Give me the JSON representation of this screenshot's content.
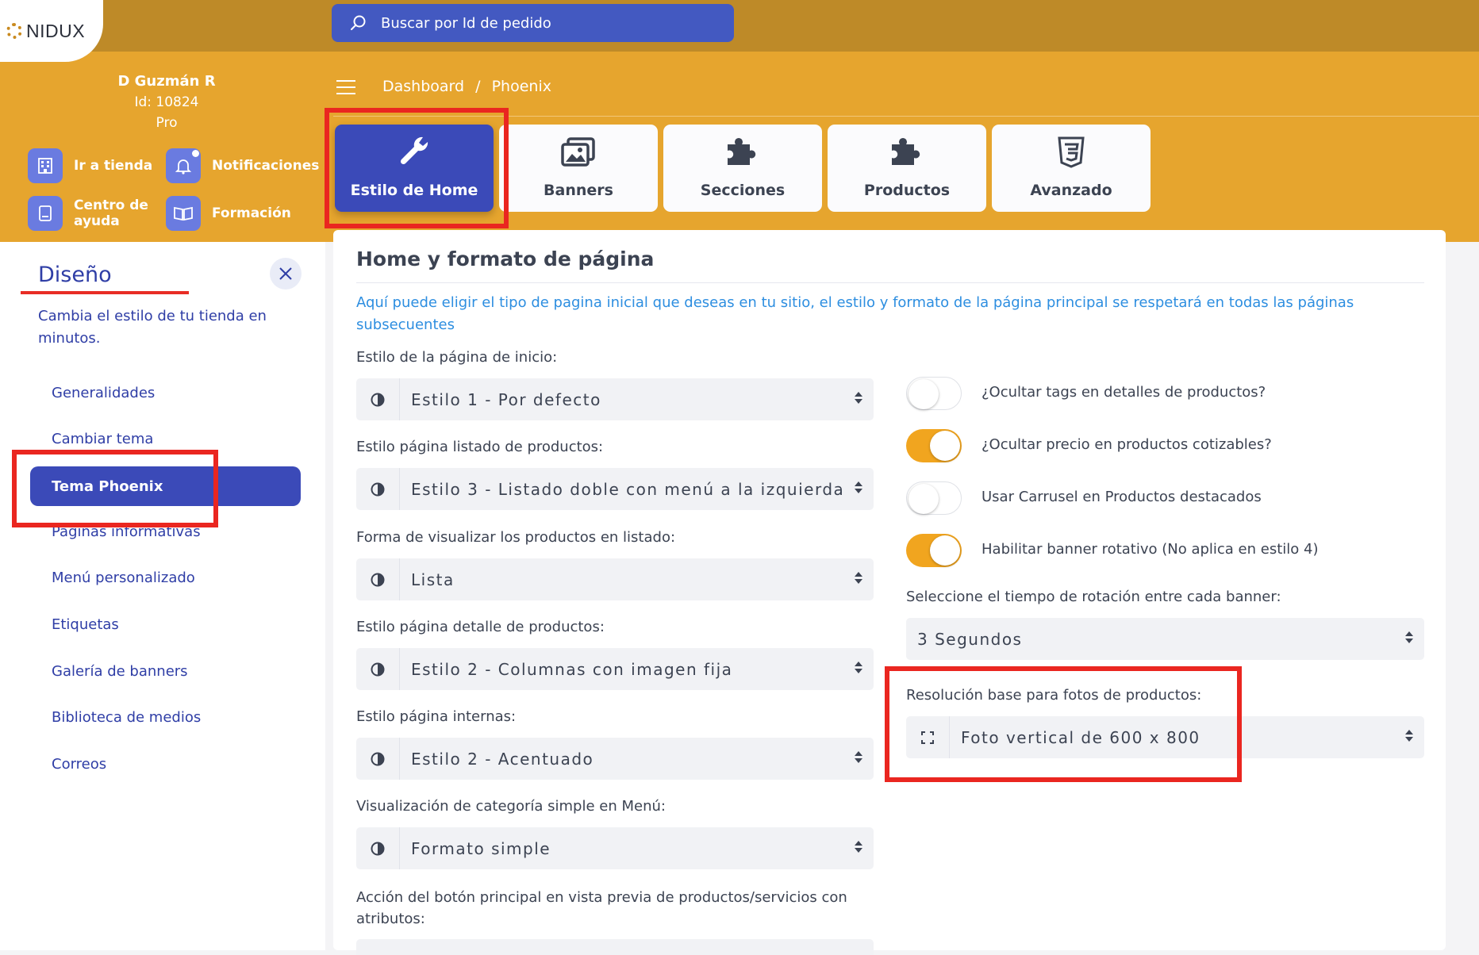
{
  "brand": {
    "name": "NIDUX"
  },
  "search": {
    "placeholder": "Buscar por Id de pedido"
  },
  "user": {
    "name": "D Guzmán R",
    "id": "Id: 10824",
    "plan": "Pro"
  },
  "quick_links": [
    {
      "label": "Ir a tienda",
      "icon": "store-icon"
    },
    {
      "label": "Notificaciones",
      "icon": "bell-icon"
    },
    {
      "label": "Centro de ayuda",
      "icon": "book-icon"
    },
    {
      "label": "Formación",
      "icon": "open-book-icon"
    }
  ],
  "breadcrumb": {
    "home": "Dashboard",
    "separator": "/",
    "current": "Phoenix"
  },
  "tabs": [
    {
      "label": "Estilo de Home",
      "icon": "wrench-icon",
      "active": true
    },
    {
      "label": "Banners",
      "icon": "images-icon"
    },
    {
      "label": "Secciones",
      "icon": "puzzle-icon"
    },
    {
      "label": "Productos",
      "icon": "puzzle-icon"
    },
    {
      "label": "Avanzado",
      "icon": "css3-icon"
    }
  ],
  "sidebar": {
    "title": "Diseño",
    "description": "Cambia el estilo de tu tienda en minutos.",
    "items": [
      {
        "label": "Generalidades"
      },
      {
        "label": "Cambiar tema"
      },
      {
        "label": "Tema Phoenix",
        "active": true
      },
      {
        "label": "Páginas informativas"
      },
      {
        "label": "Menú personalizado"
      },
      {
        "label": "Etiquetas"
      },
      {
        "label": "Galería de banners"
      },
      {
        "label": "Biblioteca de medios"
      },
      {
        "label": "Correos"
      }
    ]
  },
  "main": {
    "title": "Home y formato de página",
    "info": "Aquí puede eligir el tipo de pagina inicial que deseas en tu sitio, el estilo y formato de la página principal se respetará en todas las páginas subsecuentes",
    "left_fields": [
      {
        "label": "Estilo de la página de inicio:",
        "value": "Estilo 1 - Por defecto"
      },
      {
        "label": "Estilo página listado de productos:",
        "value": "Estilo 3 - Listado doble con menú a la izquierda"
      },
      {
        "label": "Forma de visualizar los productos en listado:",
        "value": "Lista"
      },
      {
        "label": "Estilo página detalle de productos:",
        "value": "Estilo 2 - Columnas con imagen fija"
      },
      {
        "label": "Estilo página internas:",
        "value": "Estilo 2 - Acentuado"
      },
      {
        "label": "Visualización de categoría simple en Menú:",
        "value": "Formato simple"
      },
      {
        "label": "Acción del botón principal en vista previa de productos/servicios con atributos:"
      }
    ],
    "toggles": [
      {
        "label": "¿Ocultar tags en detalles de productos?",
        "on": false
      },
      {
        "label": "¿Ocultar precio en productos cotizables?",
        "on": true
      },
      {
        "label": "Usar Carrusel en Productos destacados",
        "on": false
      },
      {
        "label": "Habilitar banner rotativo (No aplica en estilo 4)",
        "on": true
      }
    ],
    "rotation": {
      "label": "Seleccione el tiempo de rotación entre cada banner:",
      "value": "3 Segundos"
    },
    "resolution": {
      "label": "Resolución base para fotos de productos:",
      "value": "Foto vertical de 600 x 800"
    }
  },
  "colors": {
    "header": "#e6a52e",
    "topbar": "#be8a28",
    "accent": "#3b4ab8",
    "highlight": "#ea2620",
    "toggle_on": "#f1a51f"
  }
}
